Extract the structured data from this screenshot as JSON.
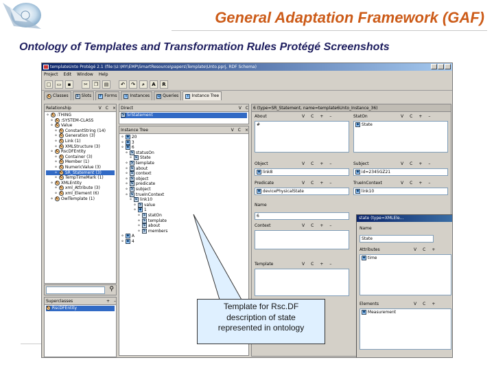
{
  "slide": {
    "title": "General Adaptation Framework (GAF)",
    "subtitle": "Ontology of Templates and Transformation Rules Protégé Screenshots"
  },
  "window": {
    "title": "templateUnto Protégé 2.1   (file:\\U:\\MY\\EMP\\SmartResource\\papers\\Template\\Unto.pprj, RDF Schema)",
    "menu": [
      "Project",
      "Edit",
      "Window",
      "Help"
    ],
    "toolbar_letters": [
      "A",
      "R"
    ],
    "tabs": [
      "Classes",
      "Slots",
      "Forms",
      "Instances",
      "Queries",
      "Instance Tree"
    ]
  },
  "relationship": {
    "header": "Relationship",
    "header_letters": [
      "V",
      "C"
    ],
    "items": [
      {
        "text": ":THING",
        "indent": 0
      },
      {
        "text": ":SYSTEM-CLASS",
        "indent": 1
      },
      {
        "text": "Value",
        "indent": 1
      },
      {
        "text": "ConstantString (14)",
        "indent": 2
      },
      {
        "text": "Generation (3)",
        "indent": 2
      },
      {
        "text": "Link (1)",
        "indent": 2
      },
      {
        "text": "XMLStructure (3)",
        "indent": 2
      },
      {
        "text": "RscDFEntity",
        "indent": 1
      },
      {
        "text": "Container (3)",
        "indent": 2
      },
      {
        "text": "Member (1)",
        "indent": 2
      },
      {
        "text": "NumericValue (3)",
        "indent": 2
      },
      {
        "text": "SR_Statement (3)",
        "indent": 2,
        "selected": true
      },
      {
        "text": "TempTimeMark (1)",
        "indent": 2
      },
      {
        "text": "XMLEntity",
        "indent": 1
      },
      {
        "text": "xml_Attribute (3)",
        "indent": 2
      },
      {
        "text": "xml_Element (6)",
        "indent": 2
      },
      {
        "text": "OwlTemplate (1)",
        "indent": 1
      }
    ],
    "superclasses_header": "Superclasses",
    "superclass": "RscDFEntity"
  },
  "direct": {
    "header": "Direct",
    "header_letters": [
      "V",
      "C"
    ],
    "item": "SrStatement"
  },
  "instance_tree": {
    "header": "Instance Tree",
    "header_letters": [
      "V",
      "C"
    ],
    "items": [
      {
        "text": "20",
        "indent": 0
      },
      {
        "text": "3",
        "indent": 0
      },
      {
        "text": "6",
        "indent": 0
      },
      {
        "text": "statusOn",
        "indent": 1
      },
      {
        "text": "State",
        "indent": 2
      },
      {
        "text": "template",
        "indent": 1
      },
      {
        "text": "about",
        "indent": 1
      },
      {
        "text": "context",
        "indent": 1
      },
      {
        "text": "object",
        "indent": 1
      },
      {
        "text": "predicate",
        "indent": 1
      },
      {
        "text": "subject",
        "indent": 1
      },
      {
        "text": "trueInContext",
        "indent": 1
      },
      {
        "text": "link10",
        "indent": 2
      },
      {
        "text": "value",
        "indent": 3
      },
      {
        "text": "1",
        "indent": 3
      },
      {
        "text": "statOn",
        "indent": 4
      },
      {
        "text": "template",
        "indent": 4
      },
      {
        "text": "about",
        "indent": 4
      },
      {
        "text": "members",
        "indent": 4
      },
      {
        "text": "A",
        "indent": 0
      },
      {
        "text": "4",
        "indent": 0
      }
    ]
  },
  "form": {
    "header": "6   (type=SR_Statement, name=template6Unto_Instance_36)",
    "letters": [
      "V",
      "C",
      "+",
      "–"
    ],
    "fields": {
      "about": {
        "label": "About",
        "value": "#"
      },
      "status": {
        "label": "StatOn",
        "value": "State"
      },
      "object": {
        "label": "Object",
        "value": "link8"
      },
      "subject": {
        "label": "Subject",
        "value": "id=2345GZ21"
      },
      "predicate": {
        "label": "Predicate",
        "value": "devicePhysicalState"
      },
      "true_in_context": {
        "label": "TrueInContext",
        "value": "link10"
      },
      "name": {
        "label": "Name",
        "value": "6"
      },
      "context": {
        "label": "Context",
        "value": ""
      },
      "template": {
        "label": "Template",
        "value": ""
      }
    }
  },
  "state_dialog": {
    "title": "state   (type=XMLEle...",
    "name_label": "Name",
    "name_value": "State",
    "attributes_label": "Attributes",
    "attributes_letters": [
      "V",
      "C",
      "+"
    ],
    "attribute_value": "time",
    "elements_label": "Elements",
    "elements_letters": [
      "V",
      "C",
      "+"
    ],
    "element_value": "Measurement"
  },
  "callout": {
    "lines": [
      "Template for Rsc.DF",
      "description of state",
      "represented in ontology"
    ]
  },
  "colors": {
    "title": "#cc5b18",
    "subtitle": "#1d1d5e",
    "callout_fill": "#dff0ff",
    "selection": "#316ac5"
  }
}
